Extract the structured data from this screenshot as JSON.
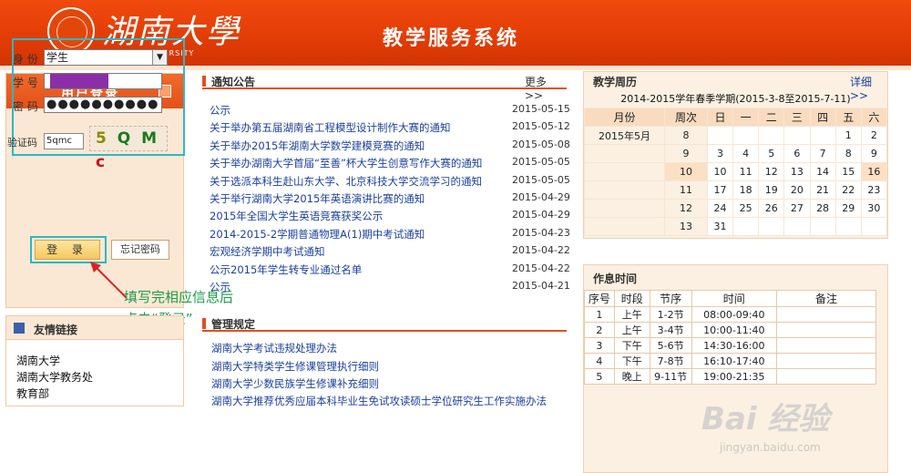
{
  "header": {
    "logo_cn": "湖南大學",
    "logo_en": "HUNAN UNIVERSITY",
    "system_title": "教学服务系统"
  },
  "login": {
    "title": "用户登录",
    "role_label": "身 份",
    "role_value": "学生",
    "user_label": "学 号",
    "pwd_label": "密 码",
    "pwd_value": "●●●●●●●●●●",
    "captcha_label": "验证码",
    "captcha_input": "5qmc",
    "captcha_chars": [
      "5",
      "Q",
      "M",
      "c"
    ],
    "login_button": "登 录",
    "forgot_button": "忘记密码"
  },
  "annotation": {
    "line1": "填写完相应信息后",
    "line2": "点击“登录”"
  },
  "links": {
    "title": "友情链接",
    "items": [
      "湖南大学",
      "湖南大学教务处",
      "教育部"
    ]
  },
  "notices": {
    "title": "通知公告",
    "more": "更多 >>",
    "items": [
      {
        "title": "公示",
        "date": "2015-05-15"
      },
      {
        "title": "关于举办第五届湖南省工程模型设计制作大赛的通知",
        "date": "2015-05-12"
      },
      {
        "title": "关于举办2015年湖南大学数学建模竞赛的通知",
        "date": "2015-05-08"
      },
      {
        "title": "关于举办湖南大学首届“至善”杯大学生创意写作大赛的通知",
        "date": "2015-05-05"
      },
      {
        "title": "关于选派本科生赴山东大学、北京科技大学交流学习的通知",
        "date": "2015-05-05"
      },
      {
        "title": "关于举行湖南大学2015年英语演讲比赛的通知",
        "date": "2015-04-29"
      },
      {
        "title": "2015年全国大学生英语竞赛获奖公示",
        "date": "2015-04-29"
      },
      {
        "title": "2014-2015-2学期普通物理A(1)期中考试通知",
        "date": "2015-04-23"
      },
      {
        "title": "宏观经济学期中考试通知",
        "date": "2015-04-22"
      },
      {
        "title": "公示2015年学生转专业通过名单",
        "date": "2015-04-22"
      },
      {
        "title": "公示",
        "date": "2015-04-21"
      }
    ]
  },
  "rules": {
    "title": "管理规定",
    "items": [
      "湖南大学考试违规处理办法",
      "湖南大学特类学生修课管理执行细则",
      "湖南大学少数民族学生修课补充细则",
      "湖南大学推荐优秀应届本科毕业生免试攻读硕士学位研究生工作实施办法"
    ]
  },
  "calendar": {
    "title": "教学周历",
    "more": "详细>>",
    "term": "2014-2015学年春季学期(2015-3-8至2015-7-11)",
    "headers": [
      "月份",
      "周次",
      "日",
      "一",
      "二",
      "三",
      "四",
      "五",
      "六"
    ],
    "rows": [
      [
        "2015年5月",
        "8",
        "",
        "",
        "",
        "",
        "",
        "1",
        "2"
      ],
      [
        "",
        "9",
        "3",
        "4",
        "5",
        "6",
        "7",
        "8",
        "9"
      ],
      [
        "",
        "10",
        "10",
        "11",
        "12",
        "13",
        "14",
        "15",
        "16"
      ],
      [
        "",
        "11",
        "17",
        "18",
        "19",
        "20",
        "21",
        "22",
        "23"
      ],
      [
        "",
        "12",
        "24",
        "25",
        "26",
        "27",
        "28",
        "29",
        "30"
      ],
      [
        "",
        "13",
        "31",
        "",
        "",
        "",
        "",
        "",
        ""
      ]
    ]
  },
  "worktime": {
    "title": "作息时间",
    "headers": [
      "序号",
      "时段",
      "节序",
      "时间",
      "备注"
    ],
    "rows": [
      [
        "1",
        "上午",
        "1-2节",
        "08:00-09:40",
        ""
      ],
      [
        "2",
        "上午",
        "3-4节",
        "10:00-11:40",
        ""
      ],
      [
        "3",
        "下午",
        "5-6节",
        "14:30-16:00",
        ""
      ],
      [
        "4",
        "下午",
        "7-8节",
        "16:10-17:40",
        ""
      ],
      [
        "5",
        "晚上",
        "9-11节",
        "19:00-21:35",
        ""
      ]
    ]
  },
  "watermark": {
    "main": "Bai 经验",
    "sub": "jingyan.baidu.com"
  }
}
